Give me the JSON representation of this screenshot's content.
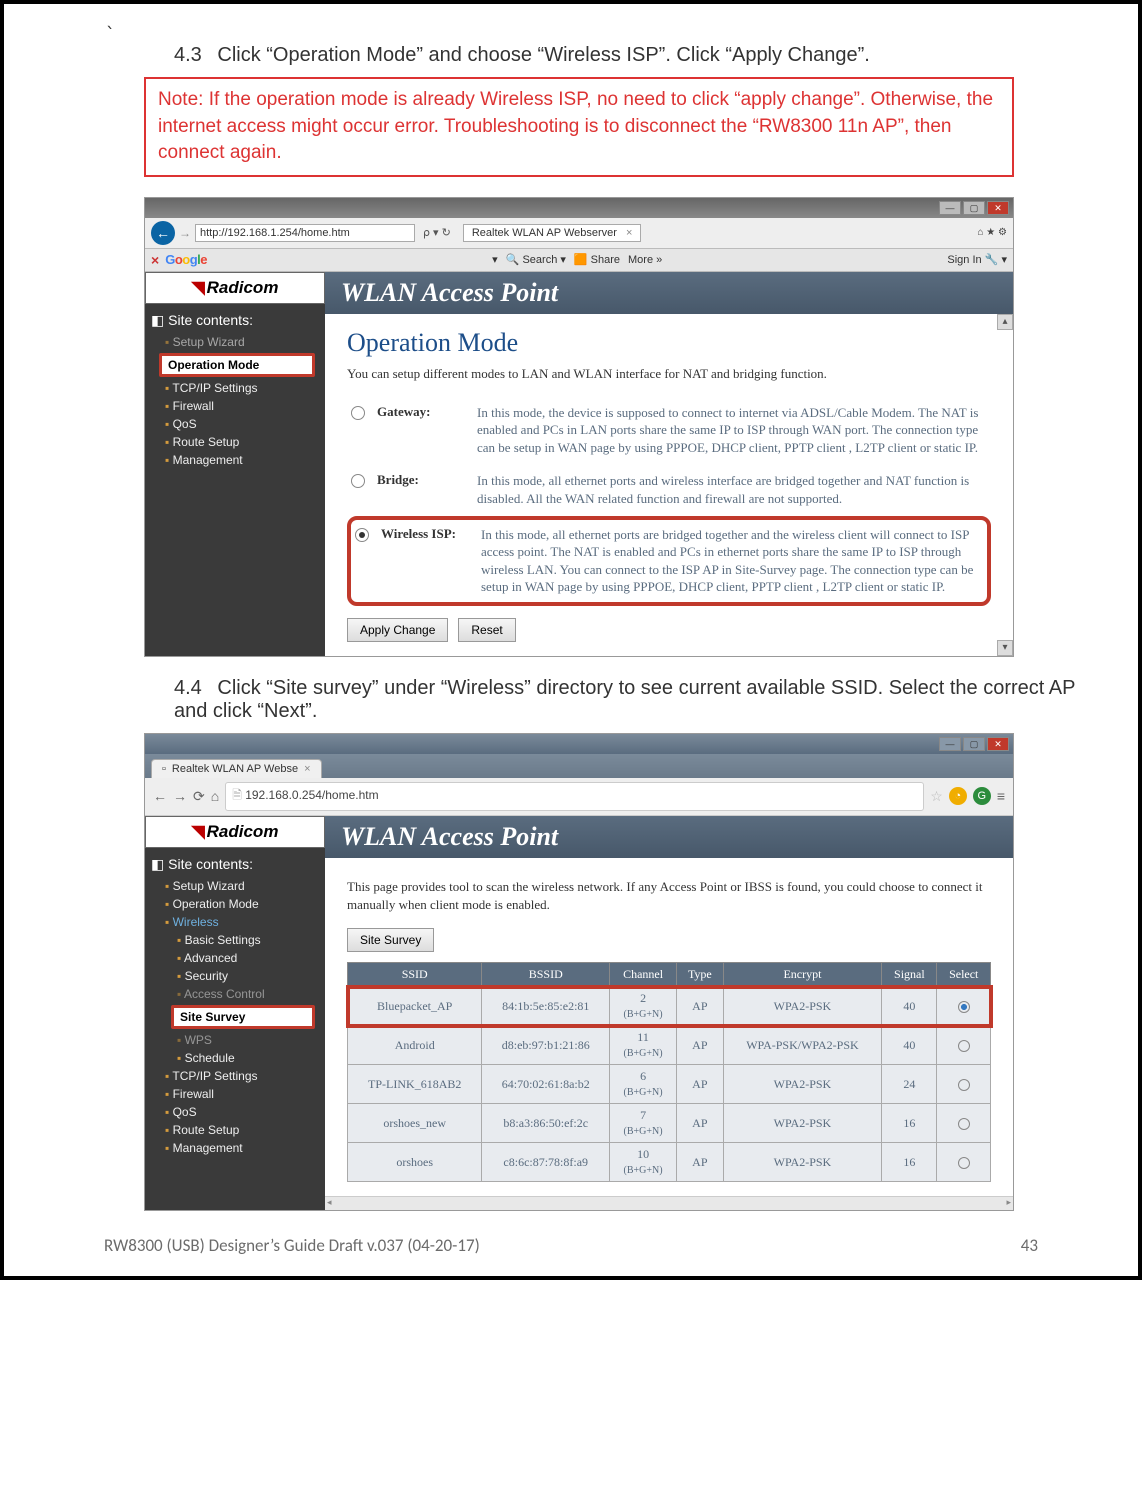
{
  "backtick": "`",
  "step43": {
    "num": "4.3",
    "text": "Click “Operation Mode” and choose “Wireless ISP”. Click “Apply Change”."
  },
  "note": "Note: If the operation mode is already Wireless ISP, no need to click “apply change”. Otherwise, the internet access might occur error. Troubleshooting is to disconnect the “RW8300 11n AP”, then connect again.",
  "shot1": {
    "address": "http://192.168.1.254/home.htm",
    "search_hint": "⍴ ▾ ↻",
    "tab_title": "Realtek WLAN AP Webserver",
    "tb_search": "Search",
    "tb_share": "Share",
    "tb_more": "More »",
    "tb_signin": "Sign In",
    "brand": "Radicom",
    "banner": "WLAN Access Point",
    "sc_title": "Site contents:",
    "tree": {
      "setup_wizard": "Setup Wizard",
      "op_mode": "Operation Mode",
      "tcpip": "TCP/IP Settings",
      "firewall": "Firewall",
      "qos": "QoS",
      "route": "Route Setup",
      "mgmt": "Management"
    },
    "h2": "Operation Mode",
    "intro": "You can setup different modes to LAN and WLAN interface for NAT and bridging function.",
    "modes": {
      "gateway": {
        "label": "Gateway:",
        "desc": "In this mode, the device is supposed to connect to internet via ADSL/Cable Modem. The NAT is enabled and PCs in LAN ports share the same IP to ISP through WAN port. The connection type can be setup in WAN page by using PPPOE, DHCP client, PPTP client , L2TP client or static IP."
      },
      "bridge": {
        "label": "Bridge:",
        "desc": "In this mode, all ethernet ports and wireless interface are bridged together and NAT function is disabled. All the WAN related function and firewall are not supported."
      },
      "wisp": {
        "label": "Wireless ISP:",
        "desc": "In this mode, all ethernet ports are bridged together and the wireless client will connect to ISP access point. The NAT is enabled and PCs in ethernet ports share the same IP to ISP through wireless LAN. You can connect to the ISP AP in Site-Survey page. The connection type can be setup in WAN page by using PPPOE, DHCP client, PPTP client , L2TP client or static IP."
      }
    },
    "btn_apply": "Apply Change",
    "btn_reset": "Reset"
  },
  "step44": {
    "num": "4.4",
    "text": "Click “Site survey” under “Wireless” directory to see current available SSID. Select the correct AP and click “Next”."
  },
  "shot2": {
    "tab_title": "Realtek WLAN AP Webse",
    "url": "192.168.0.254/home.htm",
    "brand": "Radicom",
    "banner": "WLAN Access Point",
    "sc_title": "Site contents:",
    "tree": {
      "setup": "Setup Wizard",
      "opmode": "Operation Mode",
      "wireless": "Wireless",
      "basic": "Basic Settings",
      "advanced": "Advanced",
      "security": "Security",
      "accessctl": "Access Control",
      "site": "Site Survey",
      "wps": "WPS",
      "schedule": "Schedule",
      "tcpip": "TCP/IP Settings",
      "firewall": "Firewall",
      "qos": "QoS",
      "route": "Route Setup",
      "mgmt": "Management"
    },
    "intro": "This page provides tool to scan the wireless network. If any Access Point or IBSS is found, you could choose to connect it manually when client mode is enabled.",
    "btn_survey": "Site Survey",
    "headers": {
      "ssid": "SSID",
      "bssid": "BSSID",
      "channel": "Channel",
      "type": "Type",
      "encrypt": "Encrypt",
      "signal": "Signal",
      "select": "Select"
    },
    "rows": [
      {
        "ssid": "Bluepacket_AP",
        "bssid": "84:1b:5e:85:e2:81",
        "ch": "2",
        "band": "(B+G+N)",
        "type": "AP",
        "enc": "WPA2-PSK",
        "sig": "40",
        "sel": true
      },
      {
        "ssid": "Android",
        "bssid": "d8:eb:97:b1:21:86",
        "ch": "11",
        "band": "(B+G+N)",
        "type": "AP",
        "enc": "WPA-PSK/WPA2-PSK",
        "sig": "40",
        "sel": false
      },
      {
        "ssid": "TP-LINK_618AB2",
        "bssid": "64:70:02:61:8a:b2",
        "ch": "6",
        "band": "(B+G+N)",
        "type": "AP",
        "enc": "WPA2-PSK",
        "sig": "24",
        "sel": false
      },
      {
        "ssid": "orshoes_new",
        "bssid": "b8:a3:86:50:ef:2c",
        "ch": "7",
        "band": "(B+G+N)",
        "type": "AP",
        "enc": "WPA2-PSK",
        "sig": "16",
        "sel": false
      },
      {
        "ssid": "orshoes",
        "bssid": "c8:6c:87:78:8f:a9",
        "ch": "10",
        "band": "(B+G+N)",
        "type": "AP",
        "enc": "WPA2-PSK",
        "sig": "16",
        "sel": false
      }
    ]
  },
  "footer": {
    "left": "RW8300 (USB) Designer’s Guide Draft v.037 (04-20-17)",
    "right": "43"
  }
}
